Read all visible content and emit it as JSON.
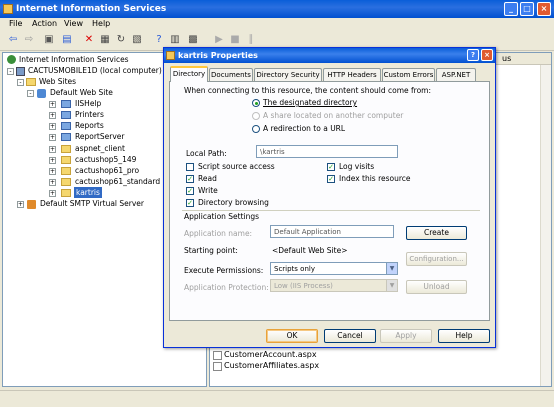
{
  "window": {
    "title": "Internet Information Services"
  },
  "menu": [
    "File",
    "Action",
    "View",
    "Help"
  ],
  "tree": {
    "root": "Internet Information Services",
    "computer": "CACTUSMOBILE1D (local computer)",
    "websites": "Web Sites",
    "defaultsite": "Default Web Site",
    "children": [
      "IISHelp",
      "Printers",
      "Reports",
      "ReportServer",
      "aspnet_client",
      "cactushop5_149",
      "cactushop61_pro",
      "cactushop61_standard",
      "kartris"
    ],
    "smtp": "Default SMTP Virtual Server"
  },
  "rightpanel": {
    "header_fragment": "us",
    "files": [
      "CustomerAccount.aspx",
      "CustomerAffiliates.aspx"
    ]
  },
  "dialog": {
    "title": "kartris Properties",
    "tabs": [
      "Directory",
      "Documents",
      "Directory Security",
      "HTTP Headers",
      "Custom Errors",
      "ASP.NET"
    ],
    "connect_label": "When connecting to this resource, the content should come from:",
    "radio1": "The designated directory",
    "radio2": "A share located on another computer",
    "radio3": "A redirection to a URL",
    "local_path_label": "Local Path:",
    "local_path_value": "\\kartris",
    "chk_script_source": "Script source access",
    "chk_read": "Read",
    "chk_write": "Write",
    "chk_dir_browse": "Directory browsing",
    "chk_log": "Log visits",
    "chk_index": "Index this resource",
    "app_settings": "Application Settings",
    "app_name_label": "Application name:",
    "app_name_value": "Default Application",
    "starting_point_label": "Starting point:",
    "starting_point_value": "<Default Web Site>",
    "exec_perm_label": "Execute Permissions:",
    "exec_perm_value": "Scripts only",
    "app_prot_label": "Application Protection:",
    "app_prot_value": "Low (IIS Process)",
    "btn_create": "Create",
    "btn_config": "Configuration...",
    "btn_unload": "Unload",
    "btn_ok": "OK",
    "btn_cancel": "Cancel",
    "btn_apply": "Apply",
    "btn_help": "Help"
  }
}
